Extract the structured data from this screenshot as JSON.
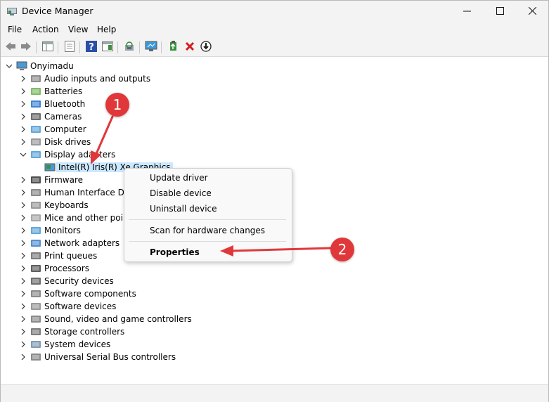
{
  "window": {
    "title": "Device Manager",
    "controls": [
      "minimize-icon",
      "maximize-icon",
      "close-icon"
    ]
  },
  "menu": [
    "File",
    "Action",
    "View",
    "Help"
  ],
  "toolbar": {
    "icons": [
      "back-arrow-icon",
      "forward-arrow-icon",
      "show-hide-console-tree-icon",
      "properties-sheet-icon",
      "help-icon",
      "action-pane-icon",
      "scan-hardware-icon",
      "monitor-icon",
      "update-driver-icon",
      "uninstall-device-icon",
      "disable-device-icon"
    ]
  },
  "tree": {
    "root": "Onyimadu",
    "categories": [
      {
        "label": "Audio inputs and outputs",
        "icon": "speaker-icon"
      },
      {
        "label": "Batteries",
        "icon": "battery-icon"
      },
      {
        "label": "Bluetooth",
        "icon": "bluetooth-icon"
      },
      {
        "label": "Cameras",
        "icon": "camera-icon"
      },
      {
        "label": "Computer",
        "icon": "computer-icon"
      },
      {
        "label": "Disk drives",
        "icon": "disk-drive-icon"
      },
      {
        "label": "Display adapters",
        "icon": "display-adapter-icon",
        "expanded": true,
        "children": [
          "Intel(R) Iris(R) Xe Graphics"
        ]
      },
      {
        "label": "Firmware",
        "icon": "firmware-icon"
      },
      {
        "label": "Human Interface Devices",
        "icon": "hid-icon"
      },
      {
        "label": "Keyboards",
        "icon": "keyboard-icon"
      },
      {
        "label": "Mice and other pointing devices",
        "icon": "mouse-icon"
      },
      {
        "label": "Monitors",
        "icon": "monitor-icon"
      },
      {
        "label": "Network adapters",
        "icon": "network-adapter-icon"
      },
      {
        "label": "Print queues",
        "icon": "printer-icon"
      },
      {
        "label": "Processors",
        "icon": "processor-icon"
      },
      {
        "label": "Security devices",
        "icon": "security-device-icon"
      },
      {
        "label": "Software components",
        "icon": "software-component-icon"
      },
      {
        "label": "Software devices",
        "icon": "software-device-icon"
      },
      {
        "label": "Sound, video and game controllers",
        "icon": "sound-controller-icon"
      },
      {
        "label": "Storage controllers",
        "icon": "storage-controller-icon"
      },
      {
        "label": "System devices",
        "icon": "system-device-icon"
      },
      {
        "label": "Universal Serial Bus controllers",
        "icon": "usb-icon"
      }
    ]
  },
  "context_menu": {
    "items": [
      "Update driver",
      "Disable device",
      "Uninstall device",
      "Scan for hardware changes",
      "Properties"
    ],
    "bold_item": "Properties"
  },
  "annotations": {
    "badges": [
      "1",
      "2"
    ],
    "color": "#e0383a"
  },
  "colors": {
    "selection": "#cce8ff",
    "chrome": "#f3f3f3",
    "annotation": "#e0383a"
  }
}
